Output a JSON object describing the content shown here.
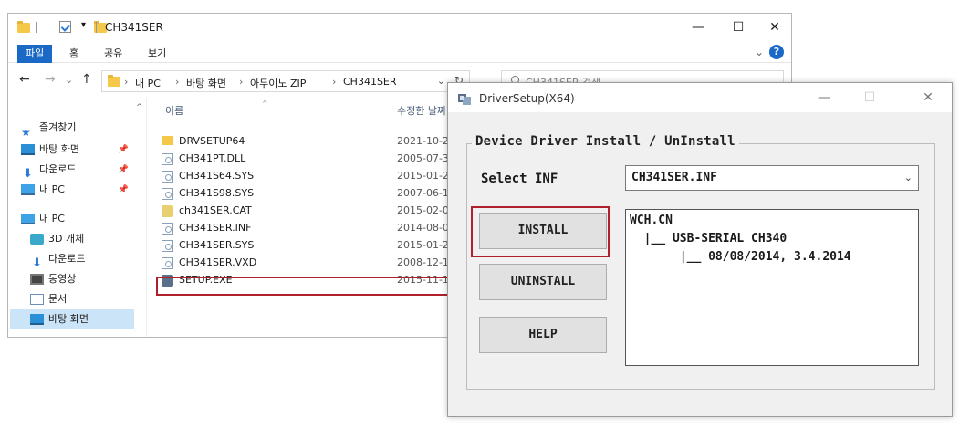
{
  "explorer": {
    "title": "CH341SER",
    "window_controls": {
      "minimize": "—",
      "maximize": "☐",
      "close": "✕"
    },
    "ribbon_tabs": [
      "파일",
      "홈",
      "공유",
      "보기"
    ],
    "ribbon_chevron": "⌄",
    "help": "?",
    "nav_buttons": {
      "back": "←",
      "forward": "→",
      "history": "⌄",
      "up": "↑"
    },
    "breadcrumbs": [
      "내 PC",
      "바탕 화면",
      "아두이노 ZIP",
      "CH341SER"
    ],
    "crumb_separator": "›",
    "address_dropdown": "⌄",
    "address_refresh": "↻",
    "search_placeholder": "CH341SER 검색",
    "columns": {
      "name": "이름",
      "date": "수정한 날짜"
    },
    "nav_scroll": "^",
    "sort_caret": "^",
    "nav_items": [
      {
        "label": "즐겨찾기",
        "pinned": false
      },
      {
        "label": "바탕 화면",
        "pinned": true
      },
      {
        "label": "다운로드",
        "pinned": true
      },
      {
        "label": "내 PC",
        "pinned": true
      },
      {
        "label": "내 PC",
        "pinned": false
      },
      {
        "label": "3D 개체",
        "pinned": false
      },
      {
        "label": "다운로드",
        "pinned": false
      },
      {
        "label": "동영상",
        "pinned": false
      },
      {
        "label": "문서",
        "pinned": false
      },
      {
        "label": "바탕 화면",
        "pinned": false,
        "selected": true
      }
    ],
    "pin_glyph": "📌",
    "files": [
      {
        "name": "DRVSETUP64",
        "date": "2021-10-26",
        "type": "folder"
      },
      {
        "name": "CH341PT.DLL",
        "date": "2005-07-30",
        "type": "file"
      },
      {
        "name": "CH341S64.SYS",
        "date": "2015-01-26",
        "type": "file"
      },
      {
        "name": "CH341S98.SYS",
        "date": "2007-06-12",
        "type": "file"
      },
      {
        "name": "ch341SER.CAT",
        "date": "2015-02-06",
        "type": "cat"
      },
      {
        "name": "CH341SER.INF",
        "date": "2014-08-08",
        "type": "file"
      },
      {
        "name": "CH341SER.SYS",
        "date": "2015-01-26",
        "type": "file"
      },
      {
        "name": "CH341SER.VXD",
        "date": "2008-12-18",
        "type": "file"
      },
      {
        "name": "SETUP.EXE",
        "date": "2015-11-14",
        "type": "exe"
      }
    ]
  },
  "dialog": {
    "title": "DriverSetup(X64)",
    "window_controls": {
      "minimize": "—",
      "maximize": "☐",
      "close": "✕"
    },
    "group_label": "Device Driver Install / UnInstall",
    "select_label": "Select INF",
    "select_value": "CH341SER.INF",
    "select_arrow": "⌄",
    "buttons": {
      "install": "INSTALL",
      "uninstall": "UNINSTALL",
      "help": "HELP"
    },
    "info_lines": [
      "WCH.CN",
      "  |__ USB-SERIAL CH340",
      "       |__ 08/08/2014, 3.4.2014"
    ]
  },
  "colors": {
    "highlight": "#b0202a",
    "accent": "#1a69c6",
    "selection": "#cce4f7"
  }
}
